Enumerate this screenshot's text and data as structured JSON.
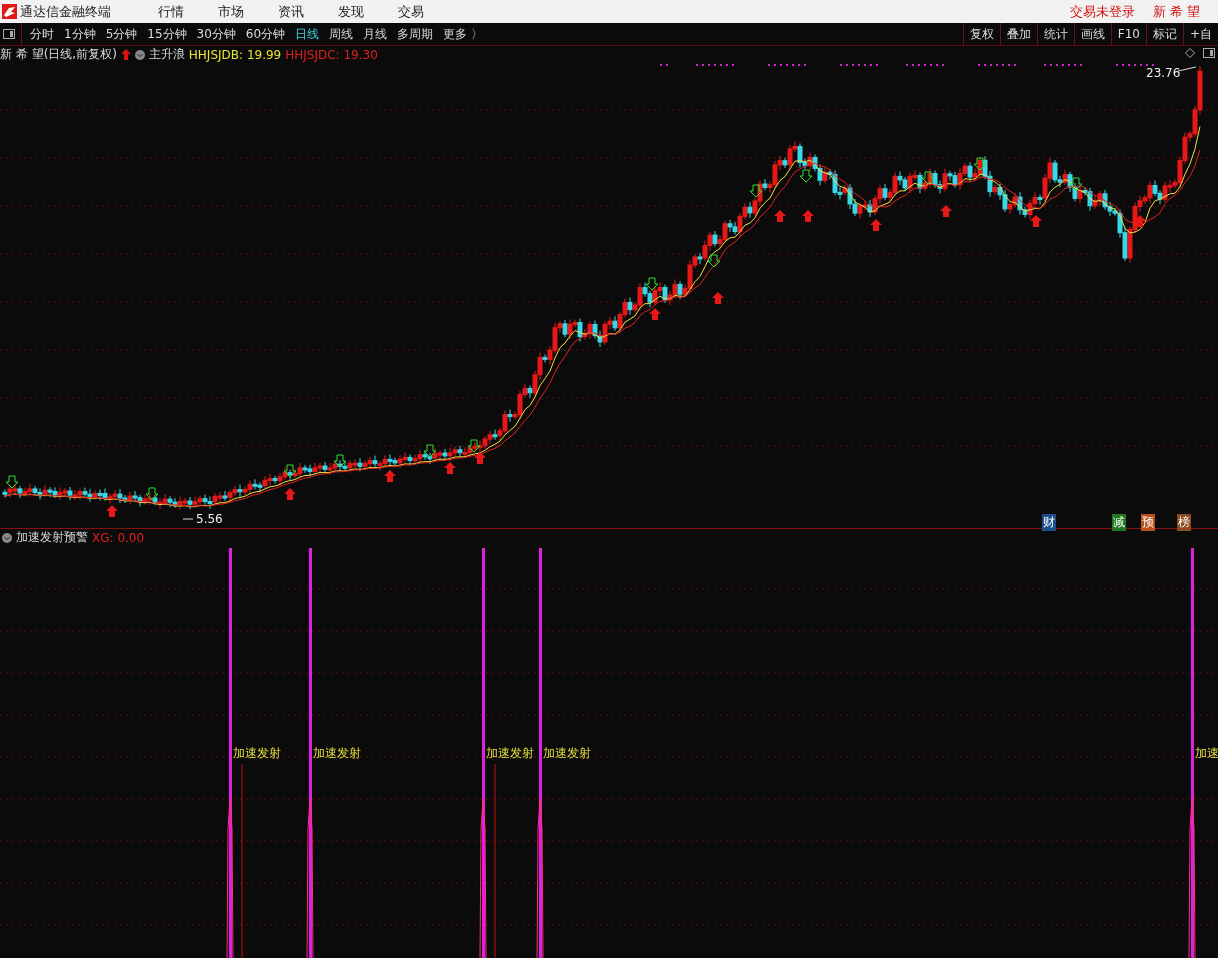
{
  "app": {
    "title": "通达信金融终端",
    "menus": [
      "行情",
      "市场",
      "资讯",
      "发现",
      "交易"
    ],
    "login_status": "交易未登录",
    "stock_name": "新 希 望"
  },
  "periods": [
    {
      "label": "分时",
      "selected": false
    },
    {
      "label": "1分钟",
      "selected": false
    },
    {
      "label": "5分钟",
      "selected": false
    },
    {
      "label": "15分钟",
      "selected": false
    },
    {
      "label": "30分钟",
      "selected": false
    },
    {
      "label": "60分钟",
      "selected": false
    },
    {
      "label": "日线",
      "selected": true
    },
    {
      "label": "周线",
      "selected": false
    },
    {
      "label": "月线",
      "selected": false
    },
    {
      "label": "多周期",
      "selected": false
    },
    {
      "label": "更多 〉",
      "selected": false
    }
  ],
  "tools": [
    "复权",
    "叠加",
    "统计",
    "画线",
    "F10",
    "标记",
    "+自"
  ],
  "main_chart": {
    "title": "新 希 望(日线,前复权)",
    "indicator": "主升浪",
    "values": [
      {
        "text": "HHJSJDB: 19.99",
        "color": "#e6e62e"
      },
      {
        "text": "HHJSJDC: 19.30",
        "color": "#e02020"
      }
    ],
    "high_label": "23.76",
    "low_label": "5.56",
    "badges": [
      {
        "text": "财",
        "color": "#1c4f8a"
      },
      {
        "text": "减",
        "color": "#1f7a1f"
      },
      {
        "text": "预",
        "color": "#b8501c"
      },
      {
        "text": "榜",
        "color": "#8a4a1c"
      }
    ]
  },
  "sub_chart": {
    "title": "加速发射预警",
    "value": "XG: 0.00",
    "signals": [
      "加速发射",
      "加速发射",
      "加速发射",
      "加速发射",
      "加速"
    ]
  }
}
